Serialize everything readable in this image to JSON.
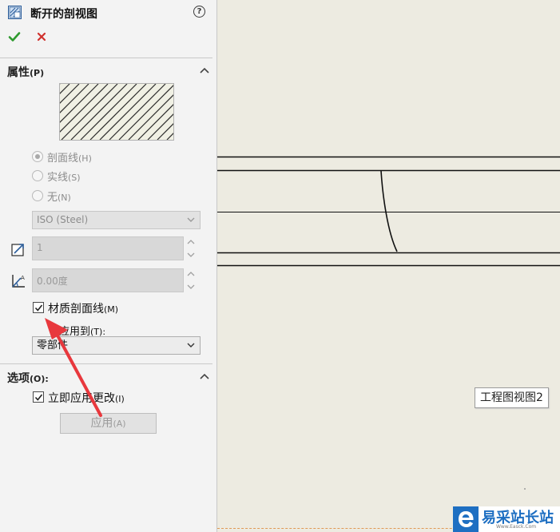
{
  "panel": {
    "title": "断开的剖视图",
    "properties": {
      "label": "属性",
      "key": "(P)"
    },
    "radios": [
      {
        "label": "剖面线",
        "key": "(H)",
        "selected": true
      },
      {
        "label": "实线",
        "key": "(S)",
        "selected": false
      },
      {
        "label": "无",
        "key": "(N)",
        "selected": false
      }
    ],
    "pattern_value": "ISO (Steel)",
    "scale_value": "1",
    "angle_value": "0.00度",
    "material_hatch": {
      "label": "材质剖面线",
      "key": "(M)",
      "checked": true
    },
    "apply_to": {
      "label": "应用到",
      "key": "(T):",
      "value": "零部件"
    },
    "options": {
      "label": "选项",
      "key": "(O):"
    },
    "apply_immediately": {
      "label": "立即应用更改",
      "key": "(I)",
      "checked": true
    },
    "apply_button": {
      "label": "应用",
      "key": "(A)"
    }
  },
  "canvas": {
    "view_label": "工程图视图2"
  },
  "watermark": {
    "text": "易采站长站",
    "sub": "Www.Easck.Com"
  },
  "colors": {
    "accept": "#2e9a2e",
    "cancel": "#d0312d",
    "canvas": "#edebe1",
    "annotation_arrow": "#e8383d",
    "watermark": "#1e6fc2"
  },
  "icons": {
    "title": "section-view-icon",
    "help": "help-icon",
    "ok": "check-icon",
    "cancel": "close-icon",
    "scale": "hatch-scale-icon",
    "angle": "hatch-angle-icon"
  }
}
